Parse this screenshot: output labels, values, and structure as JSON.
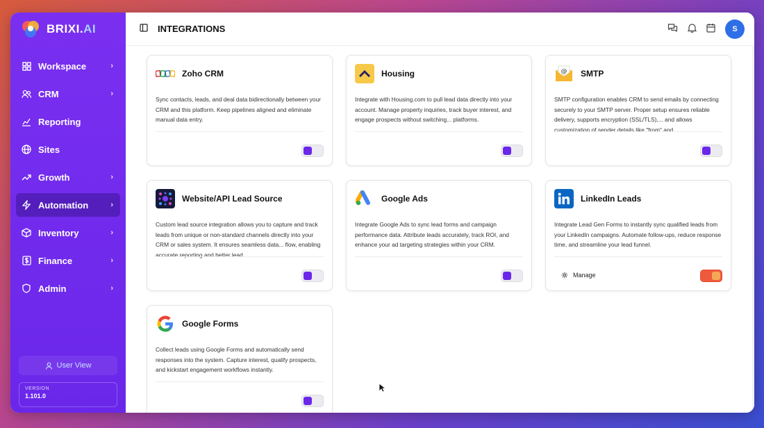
{
  "brand": {
    "name": "BRIXI.",
    "suffix": "AI"
  },
  "header": {
    "title": "INTEGRATIONS",
    "avatar_initial": "S"
  },
  "sidebar": {
    "items": [
      {
        "label": "Workspace",
        "icon": "grid-icon",
        "chevron": true
      },
      {
        "label": "CRM",
        "icon": "users-icon",
        "chevron": true
      },
      {
        "label": "Reporting",
        "icon": "chart-icon",
        "chevron": false
      },
      {
        "label": "Sites",
        "icon": "globe-icon",
        "chevron": false
      },
      {
        "label": "Growth",
        "icon": "trend-icon",
        "chevron": true
      },
      {
        "label": "Automation",
        "icon": "bolt-icon",
        "chevron": true,
        "active": true
      },
      {
        "label": "Inventory",
        "icon": "box-icon",
        "chevron": true
      },
      {
        "label": "Finance",
        "icon": "dollar-icon",
        "chevron": true
      },
      {
        "label": "Admin",
        "icon": "shield-icon",
        "chevron": true
      }
    ],
    "user_view": "User View",
    "version_label": "VERSION",
    "version_value": "1.101.0"
  },
  "integrations": [
    {
      "name": "Zoho CRM",
      "desc": "Sync contacts, leads, and deal data bidirectionally between your CRM and this platform. Keep pipelines aligned and eliminate manual data entry.",
      "enabled": false
    },
    {
      "name": "Housing",
      "desc": "Integrate with Housing.com to pull lead data directly into your account. Manage property inquiries, track buyer interest, and engage prospects without switching... platforms.",
      "enabled": false
    },
    {
      "name": "SMTP",
      "desc": "SMTP configuration enables CRM to send emails by connecting securely to your SMTP server. Proper setup ensures reliable delivery, supports encryption (SSL/TLS),... and allows customization of sender details like \"from\" and",
      "enabled": false
    },
    {
      "name": "Website/API Lead Source",
      "desc": "Custom lead source integration allows you to capture and track leads from unique or non-standard channels directly into your CRM or sales system. It ensures seamless data... flow, enabling accurate reporting and better lead",
      "enabled": false
    },
    {
      "name": "Google Ads",
      "desc": "Integrate Google Ads to sync lead forms and campaign performance data. Attribute leads accurately, track ROI, and enhance your ad targeting strategies within your CRM.",
      "enabled": false
    },
    {
      "name": "LinkedIn Leads",
      "desc": "Integrate Lead Gen Forms to instantly sync qualified leads from your LinkedIn campaigns. Automate follow-ups, reduce response time, and streamline your lead funnel.",
      "enabled": true,
      "manage_label": "Manage"
    },
    {
      "name": "Google Forms",
      "desc": "Collect leads using Google Forms and automatically send responses into the system. Capture interest, qualify prospects, and kickstart engagement workflows instantly.",
      "enabled": false
    }
  ],
  "colors": {
    "sidebar": "#7a2ff0",
    "accent": "#6a27ea",
    "toggle_on": "#f05a3c"
  }
}
